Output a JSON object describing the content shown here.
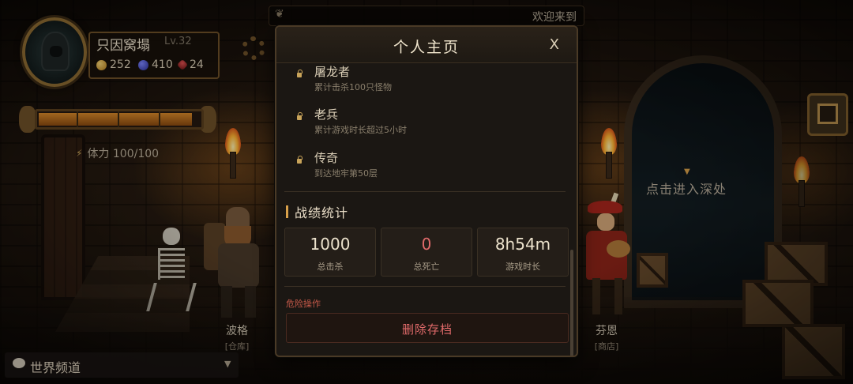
{
  "player": {
    "name": "只因窝塌",
    "level": "Lv.32",
    "gold": "252",
    "gems": "410",
    "rubies": "24",
    "hp_fraction": 0.95,
    "stamina": "体力 100/100"
  },
  "banner": {
    "text": "欢迎来到"
  },
  "scene": {
    "enter_depths": "点击进入深处",
    "npcs": [
      {
        "name": "波格",
        "role": "[仓库]"
      },
      {
        "name": "芬恩",
        "role": "[商店]"
      }
    ]
  },
  "chat": {
    "label": "世界频道",
    "caret": "▼"
  },
  "modal": {
    "title": "个人主页",
    "close": "X",
    "achievements": [
      {
        "title": "屠龙者",
        "desc": "累计击杀100只怪物"
      },
      {
        "title": "老兵",
        "desc": "累计游戏时长超过5小时"
      },
      {
        "title": "传奇",
        "desc": "到达地牢第50层"
      }
    ],
    "stats_title": "战绩统计",
    "stats": [
      {
        "value": "1000",
        "label": "总击杀"
      },
      {
        "value": "0",
        "label": "总死亡"
      },
      {
        "value": "8h54m",
        "label": "游戏时长"
      }
    ],
    "danger_label": "危险操作",
    "delete_button": "删除存档"
  },
  "colors": {
    "accent": "#d8a04a",
    "danger": "#e06a6a",
    "panel": "#1b1713"
  },
  "icons": [
    "gear-icon",
    "gold-coin-icon",
    "gem-icon",
    "ruby-icon",
    "lightning-icon",
    "chat-bubble-icon",
    "lock-icon",
    "close-icon",
    "map-frame-icon"
  ]
}
